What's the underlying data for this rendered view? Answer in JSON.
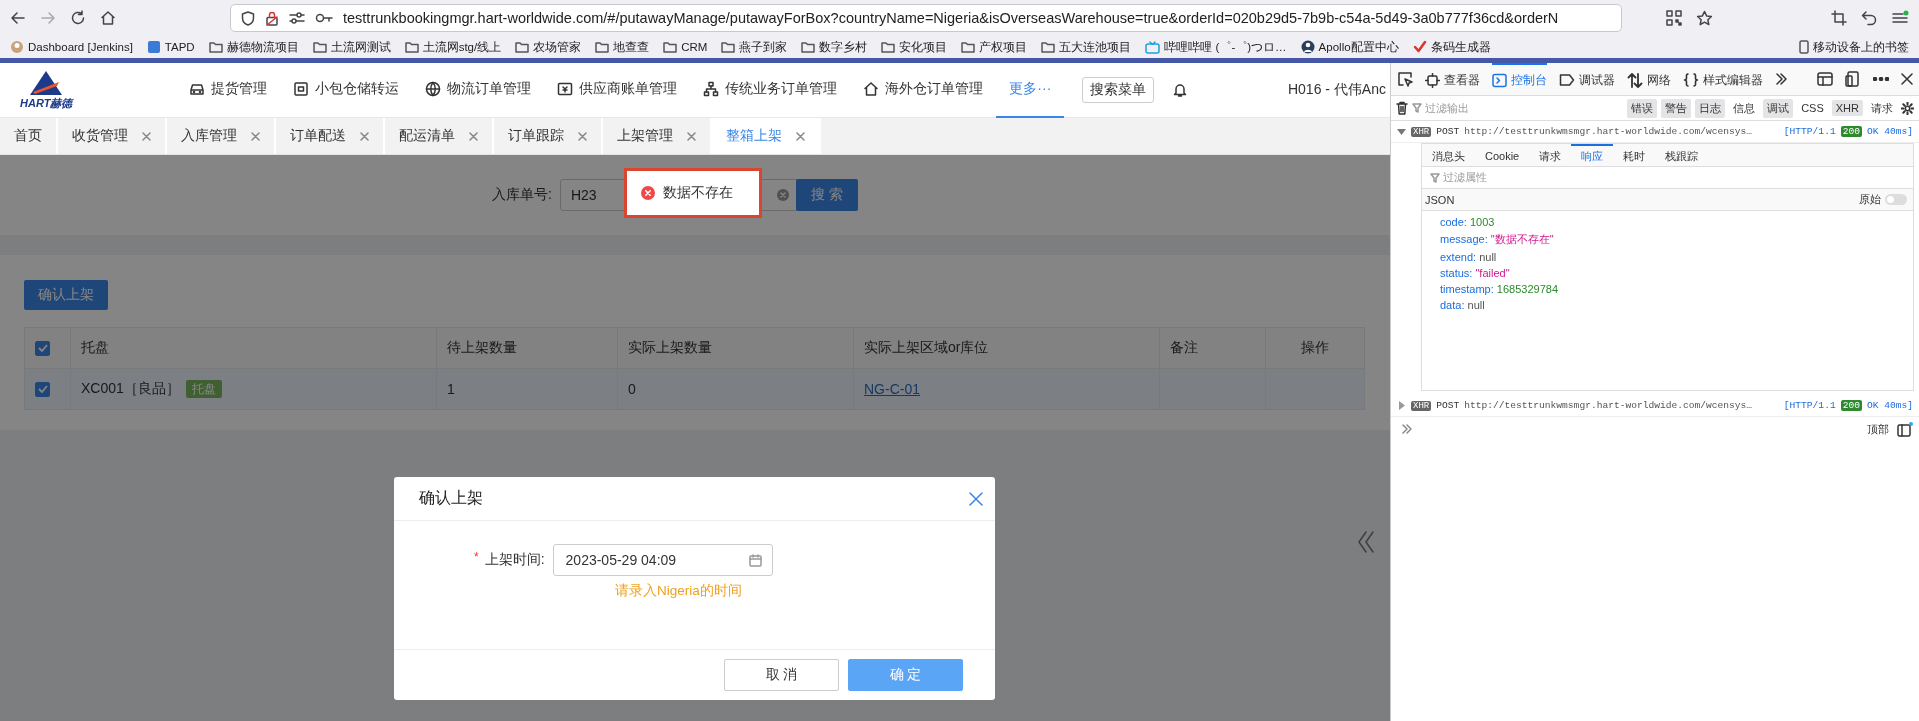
{
  "browser": {
    "url": "testtrunkbookingmgr.hart-worldwide.com/#/putawayManage/putawayForBox?countryName=Nigeria&isOverseasWarehouse=true&orderId=020b29d5-7b9b-c54a-5d49-3a0b777f36cd&orderN",
    "bookmarks": [
      {
        "label": "Dashboard [Jenkins]",
        "kind": "avatar"
      },
      {
        "label": "TAPD",
        "kind": "app"
      },
      {
        "label": "赫德物流项目",
        "kind": "folder"
      },
      {
        "label": "土流网测试",
        "kind": "folder"
      },
      {
        "label": "土流网stg/线上",
        "kind": "folder"
      },
      {
        "label": "农场管家",
        "kind": "folder"
      },
      {
        "label": "地查查",
        "kind": "folder"
      },
      {
        "label": "CRM",
        "kind": "folder"
      },
      {
        "label": "燕子到家",
        "kind": "folder"
      },
      {
        "label": "数字乡村",
        "kind": "folder"
      },
      {
        "label": "安化项目",
        "kind": "folder"
      },
      {
        "label": "产权项目",
        "kind": "folder"
      },
      {
        "label": "五大连池项目",
        "kind": "folder"
      },
      {
        "label": "哔哩哔哩 (゜-゜)つロ…",
        "kind": "tv"
      },
      {
        "label": "Apollo配置中心",
        "kind": "person"
      },
      {
        "label": "条码生成器",
        "kind": "check"
      }
    ],
    "mobile_bookmarks": "移动设备上的书签"
  },
  "app": {
    "logo": "HART赫德",
    "nav": [
      {
        "label": "提货管理",
        "kind": "car",
        "selected": false
      },
      {
        "label": "小包仓储转运",
        "kind": "box",
        "selected": false
      },
      {
        "label": "物流订单管理",
        "kind": "globe",
        "selected": false
      },
      {
        "label": "供应商账单管理",
        "kind": "invoice",
        "selected": false
      },
      {
        "label": "传统业务订单管理",
        "kind": "tree",
        "selected": false
      },
      {
        "label": "海外仓订单管理",
        "kind": "house",
        "selected": false
      },
      {
        "label": "更多···",
        "kind": "text",
        "selected": true
      }
    ],
    "search_menu": "搜索菜单",
    "user": "H016 - 代伟Anc",
    "tabs": [
      {
        "label": "首页",
        "selected": false,
        "closable": false
      },
      {
        "label": "收货管理",
        "selected": false,
        "closable": true
      },
      {
        "label": "入库管理",
        "selected": false,
        "closable": true
      },
      {
        "label": "订单配送",
        "selected": false,
        "closable": true
      },
      {
        "label": "配运清单",
        "selected": false,
        "closable": true
      },
      {
        "label": "订单跟踪",
        "selected": false,
        "closable": true
      },
      {
        "label": "上架管理",
        "selected": false,
        "closable": true
      },
      {
        "label": "整箱上架",
        "selected": true,
        "closable": true
      }
    ],
    "search": {
      "label": "入库单号:",
      "value": "H23",
      "button": "搜 索"
    },
    "confirm_button": "确认上架",
    "table": {
      "all_checked": true,
      "columns": [
        "托盘",
        "待上架数量",
        "实际上架数量",
        "实际上架区域or库位",
        "备注",
        "操作"
      ],
      "rows": [
        {
          "checked": true,
          "pallet": "XC001［良品］",
          "tag": "托盘",
          "pending_qty": "1",
          "actual_qty": "0",
          "location": "NG-C-01"
        }
      ]
    },
    "toast": {
      "message": "数据不存在"
    },
    "dialog": {
      "title": "确认上架",
      "required_mark": "*",
      "field_label": "上架时间:",
      "value": "2023-05-29 04:09",
      "hint": "请录入Nigeria的时间",
      "buttons": [
        {
          "label": "取 消",
          "kind": "default"
        },
        {
          "label": "确 定",
          "kind": "primary"
        }
      ]
    }
  },
  "devtools": {
    "tools": [
      {
        "label": "查看器",
        "kind": "inspector",
        "selected": false
      },
      {
        "label": "控制台",
        "kind": "console",
        "selected": true
      },
      {
        "label": "调试器",
        "kind": "debugger",
        "selected": false
      },
      {
        "label": "网络",
        "kind": "network",
        "selected": false
      },
      {
        "label": "样式编辑器",
        "kind": "braces",
        "selected": false
      }
    ],
    "filter_placeholder": "过滤输出",
    "filters": [
      {
        "label": "错误",
        "selected": true
      },
      {
        "label": "警告",
        "selected": true
      },
      {
        "label": "日志",
        "selected": true
      },
      {
        "label": "信息",
        "selected": false
      },
      {
        "label": "调试",
        "selected": true
      },
      {
        "label": "CSS",
        "selected": false
      },
      {
        "label": "XHR",
        "selected": true
      },
      {
        "label": "请求",
        "selected": false
      }
    ],
    "requests": [
      {
        "expanded": true,
        "badge": "XHR",
        "method": "POST",
        "url": "http://testtrunkwmsmgr.hart-worldwide.com/wcensys…",
        "protocol": "[HTTP/1.1",
        "status": "200",
        "result": "OK 40ms]"
      },
      {
        "expanded": false,
        "badge": "XHR",
        "method": "POST",
        "url": "http://testtrunkwmsmgr.hart-worldwide.com/wcensys…",
        "protocol": "[HTTP/1.1",
        "status": "200",
        "result": "OK 40ms]"
      }
    ],
    "detail": {
      "tabs": [
        {
          "label": "消息头",
          "selected": false
        },
        {
          "label": "Cookie",
          "selected": false
        },
        {
          "label": "请求",
          "selected": false
        },
        {
          "label": "响应",
          "selected": true
        },
        {
          "label": "耗时",
          "selected": false
        },
        {
          "label": "栈跟踪",
          "selected": false
        }
      ],
      "filter_placeholder": "过滤属性",
      "format": "JSON",
      "raw_label": "原始",
      "raw_on": false,
      "properties": [
        {
          "key": "code:",
          "value": "1003",
          "kind": "number"
        },
        {
          "key": "message:",
          "value": "\"数据不存在\"",
          "kind": "string"
        },
        {
          "key": "extend:",
          "value": "null",
          "kind": "null"
        },
        {
          "key": "status:",
          "value": "\"failed\"",
          "kind": "string"
        },
        {
          "key": "timestamp:",
          "value": "1685329784",
          "kind": "number"
        },
        {
          "key": "data:",
          "value": "null",
          "kind": "null"
        }
      ]
    },
    "context": "顶部"
  }
}
